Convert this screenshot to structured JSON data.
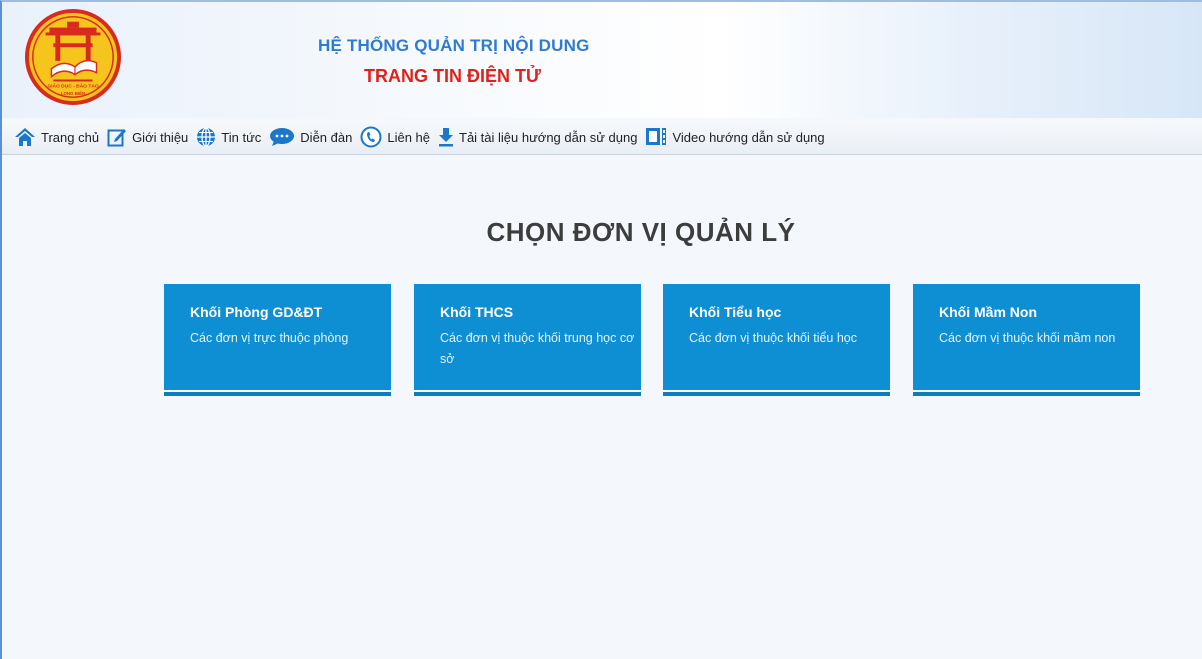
{
  "header": {
    "logo_text_top": "GIÁO DỤC - ĐÀO TẠO",
    "logo_text_bottom": "LONG BIÊN",
    "title_line1": "HỆ THỐNG QUẢN TRỊ NỘI DUNG",
    "title_line2": "TRANG TIN ĐIỆN TỬ"
  },
  "nav": {
    "items": [
      {
        "label": "Trang chủ",
        "icon": "home-icon"
      },
      {
        "label": "Giới thiệu",
        "icon": "edit-icon"
      },
      {
        "label": "Tin tức",
        "icon": "globe-icon"
      },
      {
        "label": "Diễn đàn",
        "icon": "chat-icon"
      },
      {
        "label": "Liên hệ",
        "icon": "phone-icon"
      },
      {
        "label": "Tải tài liệu hướng dẫn sử dụng",
        "icon": "download-icon"
      },
      {
        "label": "Video hướng dẫn sử dụng",
        "icon": "video-icon"
      }
    ]
  },
  "main": {
    "heading": "CHỌN ĐƠN VỊ QUẢN LÝ",
    "cards": [
      {
        "title": "Khối Phòng GD&ĐT",
        "desc": "Các đơn vị trực thuộc phòng"
      },
      {
        "title": "Khối THCS",
        "desc": "Các đơn vị thuộc khối trung học cơ sở"
      },
      {
        "title": "Khối Tiểu học",
        "desc": "Các đơn vị thuộc khối tiểu học"
      },
      {
        "title": "Khối Mầm Non",
        "desc": "Các đơn vị thuộc khối mầm non"
      }
    ]
  },
  "colors": {
    "accent_blue": "#0e8fd4",
    "title_blue": "#2f7bd1",
    "title_red": "#e0221c",
    "logo_ring": "#d92a1f",
    "logo_fill": "#f6c51d"
  }
}
